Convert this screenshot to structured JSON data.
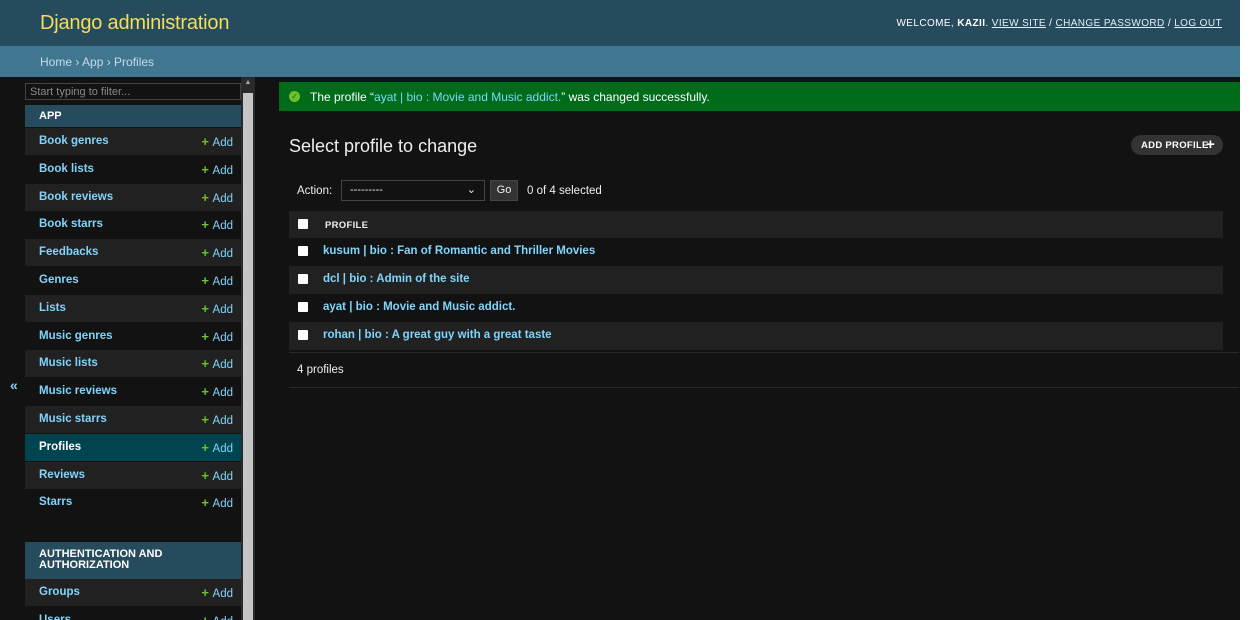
{
  "header": {
    "brand": "Django administration",
    "welcome": "WELCOME, ",
    "username": "KAZII",
    "view_site": "VIEW SITE",
    "change_password": "CHANGE PASSWORD",
    "log_out": "LOG OUT",
    "sep": " / ",
    "dot": ". "
  },
  "breadcrumbs": "Home › App › Profiles",
  "sidebar": {
    "filter_placeholder": "Start typing to filter...",
    "app_caption": "APP",
    "add_label": "Add",
    "app_models": [
      {
        "label": "Book genres"
      },
      {
        "label": "Book lists"
      },
      {
        "label": "Book reviews"
      },
      {
        "label": "Book starrs"
      },
      {
        "label": "Feedbacks"
      },
      {
        "label": "Genres"
      },
      {
        "label": "Lists"
      },
      {
        "label": "Music genres"
      },
      {
        "label": "Music lists"
      },
      {
        "label": "Music reviews"
      },
      {
        "label": "Music starrs"
      },
      {
        "label": "Profiles",
        "selected": true
      },
      {
        "label": "Reviews"
      },
      {
        "label": "Starrs"
      }
    ],
    "auth_caption": "AUTHENTICATION AND AUTHORIZATION",
    "auth_models": [
      {
        "label": "Groups"
      },
      {
        "label": "Users"
      }
    ],
    "toggle": "«"
  },
  "message": {
    "prefix": "The profile “",
    "link": "ayat | bio : Movie and Music addict.",
    "suffix": "” was changed successfully."
  },
  "main": {
    "title": "Select profile to change",
    "add_button": "ADD PROFILE",
    "action_label": "Action:",
    "action_value": "---------",
    "go_label": "Go",
    "selected_count": "0 of 4 selected",
    "column_header": "PROFILE",
    "rows": [
      "kusum | bio : Fan of Romantic and Thriller Movies",
      "dcl | bio : Admin of the site",
      "ayat | bio : Movie and Music addict.",
      "rohan | bio : A great guy with a great taste"
    ],
    "footer_count": "4 profiles"
  },
  "colors": {
    "header_bg": "#264b5d",
    "breadcrumb_bg": "#417690",
    "brand": "#f5dd5d",
    "link": "#81d4fa",
    "success_bg": "#006b1b",
    "add_plus": "#70bf2b",
    "selected_row": "#004450"
  }
}
